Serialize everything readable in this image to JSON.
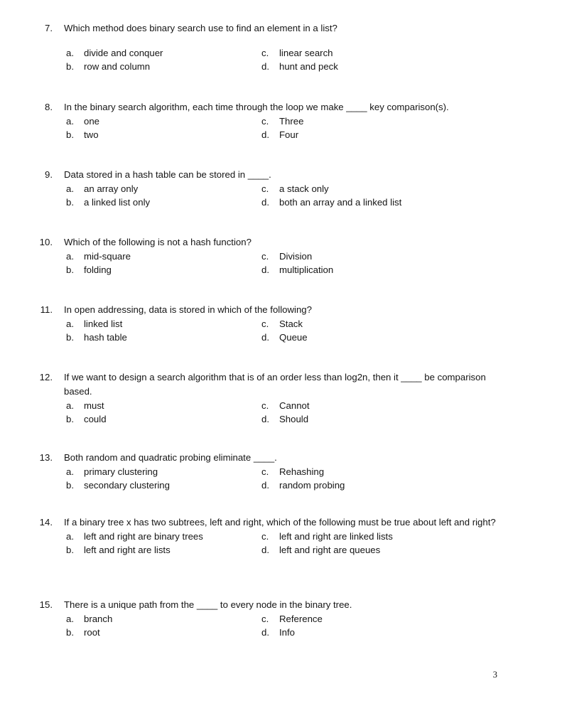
{
  "page": {
    "page_number": "3",
    "background_color": "#ffffff",
    "text_color": "#151515"
  },
  "questions": [
    {
      "number": "7.",
      "stem": "Which method does binary search use to find an element in a list?",
      "extra_gap_before_options": true,
      "options": {
        "a": "divide and conquer",
        "b": "row and column",
        "c": "linear search",
        "d": "hunt and peck"
      },
      "labels": {
        "a": "a.",
        "b": "b.",
        "c": "c.",
        "d": "d."
      }
    },
    {
      "number": "8.",
      "stem": "In the binary search algorithm, each time through the loop we make ____ key comparison(s).",
      "extra_gap_before_options": false,
      "options": {
        "a": "one",
        "b": "two",
        "c": "Three",
        "d": "Four"
      },
      "labels": {
        "a": "a.",
        "b": "b.",
        "c": "c.",
        "d": "d."
      }
    },
    {
      "number": "9.",
      "stem": "Data stored in a hash table can be stored in ____.",
      "extra_gap_before_options": false,
      "options": {
        "a": "an array only",
        "b": "a linked list only",
        "c": "a stack only",
        "d": "both an array and a linked list"
      },
      "labels": {
        "a": "a.",
        "b": "b.",
        "c": "c.",
        "d": "d."
      }
    },
    {
      "number": "10.",
      "stem": "Which of the following is not a hash function?",
      "extra_gap_before_options": false,
      "options": {
        "a": "mid-square",
        "b": "folding",
        "c": "Division",
        "d": "multiplication"
      },
      "labels": {
        "a": "a.",
        "b": "b.",
        "c": "c.",
        "d": "d."
      }
    },
    {
      "number": "11.",
      "stem": "In open addressing, data is stored in which of the following?",
      "extra_gap_before_options": false,
      "options": {
        "a": "linked list",
        "b": "hash table",
        "c": "Stack",
        "d": "Queue"
      },
      "labels": {
        "a": "a.",
        "b": "b.",
        "c": "c.",
        "d": "d."
      }
    },
    {
      "number": "12.",
      "stem": "If we want to design a search algorithm that is of an order less than log2n, then it ____ be comparison based.",
      "extra_gap_before_options": false,
      "options": {
        "a": "must",
        "b": "could",
        "c": "Cannot",
        "d": "Should"
      },
      "labels": {
        "a": "a.",
        "b": "b.",
        "c": "c.",
        "d": "d."
      }
    },
    {
      "number": "13.",
      "stem": "Both random and quadratic probing eliminate ____.",
      "extra_gap_before_options": false,
      "options": {
        "a": "primary clustering",
        "b": "secondary clustering",
        "c": "Rehashing",
        "d": "random probing"
      },
      "labels": {
        "a": "a.",
        "b": "b.",
        "c": "c.",
        "d": "d."
      }
    },
    {
      "number": "14.",
      "stem": "If a binary tree x has two subtrees, left and right, which of the following must be true about left and right?",
      "extra_gap_before_options": false,
      "options": {
        "a": "left and right are binary trees",
        "b": "left and right are lists",
        "c": "left and right are linked lists",
        "d": "left and right are queues"
      },
      "labels": {
        "a": "a.",
        "b": "b.",
        "c": "c.",
        "d": "d."
      }
    },
    {
      "number": "15.",
      "stem": "There is a unique path from the ____ to every node in the binary tree.",
      "extra_gap_before_options": false,
      "options": {
        "a": "branch",
        "b": "root",
        "c": "Reference",
        "d": "Info"
      },
      "labels": {
        "a": "a.",
        "b": "b.",
        "c": "c.",
        "d": "d."
      }
    }
  ],
  "layout": {
    "question_tops": [
      30,
      141,
      236,
      331,
      426,
      521,
      634,
      725,
      841
    ]
  }
}
